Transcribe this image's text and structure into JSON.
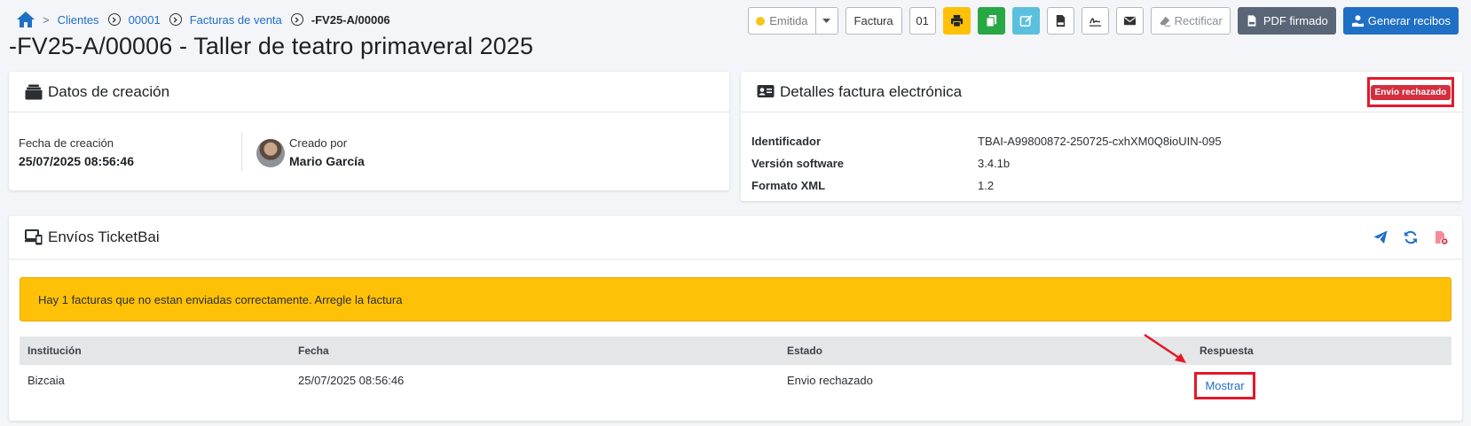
{
  "breadcrumb": {
    "items": [
      "Clientes",
      "00001",
      "Facturas de venta"
    ],
    "current": "-FV25-A/00006"
  },
  "toolbar": {
    "status_label": "Emitida",
    "status_dot_color": "#f5c518",
    "type_label": "Factura",
    "series_label": "01",
    "rectify_label": "Rectificar",
    "pdf_signed_label": "PDF firmado",
    "generate_receipts_label": "Generar recibos",
    "icons": [
      "print-icon",
      "copy-icon",
      "edit-icon",
      "xml-file-icon",
      "signature-icon",
      "envelope-icon",
      "eraser-icon",
      "pdf-icon",
      "user-hand-icon"
    ]
  },
  "page": {
    "title": "-FV25-A/00006 - Taller de teatro primaveral 2025"
  },
  "creation": {
    "title": "Datos de creación",
    "date_label": "Fecha de creación",
    "date_value": "25/07/2025 08:56:46",
    "created_by_label": "Creado por",
    "created_by_value": "Mario García"
  },
  "einvoice": {
    "title": "Detalles factura electrónica",
    "badge": "Envio rechazado",
    "rows": [
      {
        "key": "Identificador",
        "value": "TBAI-A99800872-250725-cxhXM0Q8ioUIN-095"
      },
      {
        "key": "Versión software",
        "value": "3.4.1b"
      },
      {
        "key": "Formato XML",
        "value": "1.2"
      }
    ]
  },
  "ticketbai": {
    "title": "Envíos TicketBai",
    "alert": "Hay 1 facturas que no estan enviadas correctamente. Arregle la factura",
    "columns": [
      "Institución",
      "Fecha",
      "Estado",
      "Respuesta"
    ],
    "rows": [
      {
        "institution": "Bizcaia",
        "date": "25/07/2025 08:56:46",
        "status": "Envio rechazado",
        "response": "Mostrar"
      }
    ]
  },
  "colors": {
    "primary": "#1f6fc5",
    "warning": "#ffc107",
    "danger": "#d32f3f",
    "success": "#28a745",
    "info": "#5bc0de",
    "dark": "#5a6677",
    "highlight": "#e3192a"
  }
}
